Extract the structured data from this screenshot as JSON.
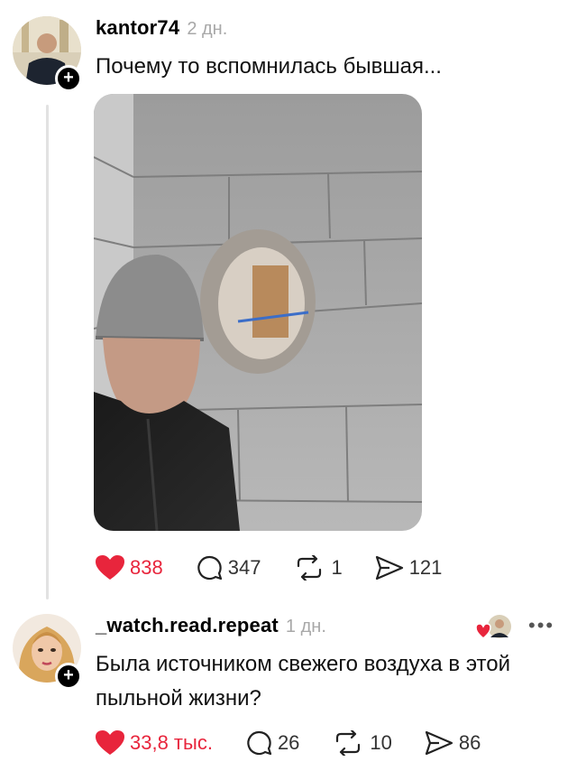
{
  "post": {
    "username": "kantor74",
    "time": "2 дн.",
    "text": "Почему то вспомнилась бывшая...",
    "stats": {
      "likes": "838",
      "comments": "347",
      "reposts": "1",
      "shares": "121"
    }
  },
  "reply": {
    "username": "_watch.read.repeat",
    "time": "1 дн.",
    "text_line1": "Была источником свежего воздуха в этой",
    "text_line2": "пыльной жизни?",
    "stats": {
      "likes": "33,8 тыс.",
      "comments": "26",
      "reposts": "10",
      "shares": "86"
    }
  },
  "colors": {
    "like_red": "#e8253c",
    "thread_line": "#e2e2e2",
    "muted": "#a8a8a8"
  },
  "icons": [
    "plus-icon",
    "heart-icon",
    "comment-icon",
    "repost-icon",
    "share-icon",
    "more-icon"
  ]
}
